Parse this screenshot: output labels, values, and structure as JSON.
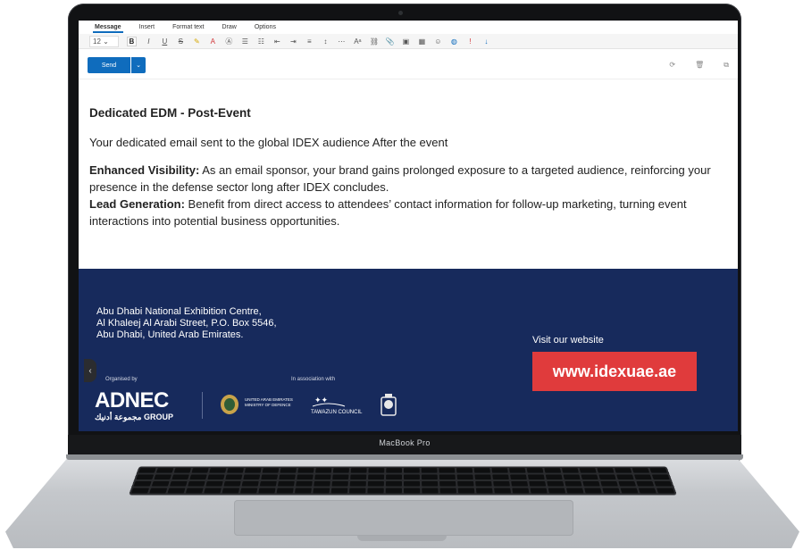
{
  "device": {
    "model_label": "MacBook Pro"
  },
  "menu": {
    "tabs": [
      {
        "label": "Message",
        "active": true
      },
      {
        "label": "Insert",
        "active": false
      },
      {
        "label": "Format text",
        "active": false
      },
      {
        "label": "Draw",
        "active": false
      },
      {
        "label": "Options",
        "active": false
      }
    ]
  },
  "toolbar": {
    "font_size": "12",
    "icons": [
      "bold-icon",
      "italic-icon",
      "underline-icon",
      "strikethrough-icon",
      "highlight-icon",
      "font-color-icon",
      "clear-format-icon",
      "bullets-icon",
      "numbering-icon",
      "decrease-indent-icon",
      "increase-indent-icon",
      "align-icon",
      "spacing-icon",
      "more-icon",
      "styles-icon",
      "link-icon",
      "attach-icon",
      "image-icon",
      "table-icon",
      "emoji-icon",
      "dictate-icon",
      "importance-icon",
      "sensitivity-icon"
    ]
  },
  "actions": {
    "send_label": "Send",
    "send_options_icon": "chevron-down-icon"
  },
  "email": {
    "headline": "Dedicated EDM - Post-Event",
    "intro": "Your dedicated email sent to the global IDEX audience After the event",
    "visibility_label": "Enhanced Visibility:",
    "visibility_text": " As an email sponsor, your brand gains prolonged exposure to a targeted audience, reinforcing your presence in the defense sector long after IDEX concludes.",
    "lead_label": "Lead Generation:",
    "lead_text": " Benefit from direct access to attendees’ contact information for follow-up marketing, turning event interactions into potential business opportunities."
  },
  "footer": {
    "address_line1": "Abu Dhabi National Exhibition Centre,",
    "address_line2": "Al Khaleej Al Arabi Street, P.O. Box 5546,",
    "address_line3": "Abu Dhabi, United Arab Emirates.",
    "visit_label": "Visit our website",
    "website": "www.idexuae.ae",
    "organised_by": "Organised by",
    "in_association": "In association with",
    "adnec_name": "ADNEC",
    "adnec_sub": "مجموعة أدنيك GROUP",
    "mod_text_line1": "UNITED ARAB EMIRATES",
    "mod_text_line2": "MINISTRY OF DEFENCE",
    "tawazun_text": "TAWAZUN COUNCIL",
    "colors": {
      "banner": "#172a5c",
      "url_button": "#e03b3c"
    }
  }
}
